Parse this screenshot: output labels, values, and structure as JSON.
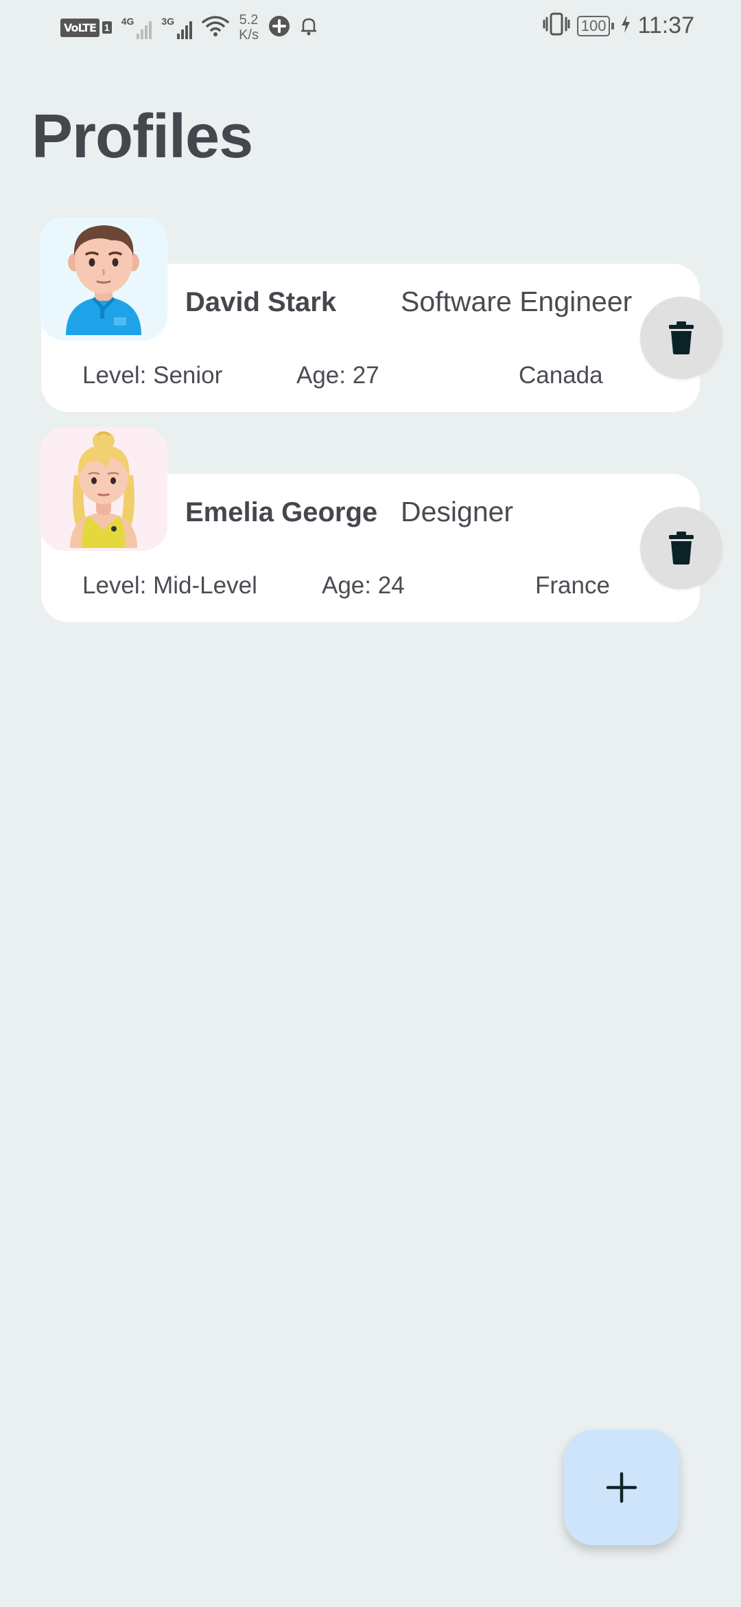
{
  "status_bar": {
    "volte": "VoLTE",
    "sim": "1",
    "net1": "4G",
    "net2": "3G",
    "speed_value": "5.2",
    "speed_unit": "K/s",
    "battery": "100",
    "time": "11:37"
  },
  "page": {
    "title": "Profiles"
  },
  "profiles": [
    {
      "name": "David Stark",
      "role": "Software Engineer",
      "level": "Level: Senior",
      "age": "Age: 27",
      "country": "Canada",
      "avatar_icon": "male-avatar-icon"
    },
    {
      "name": "Emelia George",
      "role": "Designer",
      "level": "Level: Mid-Level",
      "age": "Age: 24",
      "country": "France",
      "avatar_icon": "female-avatar-icon"
    }
  ],
  "actions": {
    "delete_icon": "trash-icon",
    "add_icon": "plus-icon"
  },
  "colors": {
    "background": "#eaeff0",
    "card": "#ffffff",
    "fab": "#cde4fb",
    "delete_button": "#e0e0e0",
    "avatar1_bg": "#eaf8fd",
    "avatar2_bg": "#fdeef3"
  }
}
